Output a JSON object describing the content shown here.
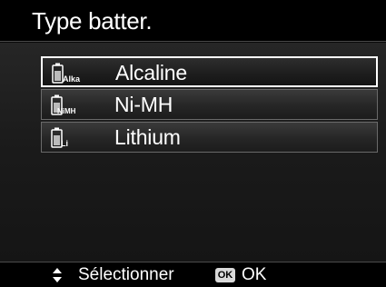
{
  "header": {
    "title": "Type batter."
  },
  "menu": {
    "items": [
      {
        "label": "Alcaline",
        "icon": "battery-alkaline-icon",
        "icon_text": "Alka",
        "selected": true
      },
      {
        "label": "Ni-MH",
        "icon": "battery-nimh-icon",
        "icon_text": "NiMH",
        "selected": false
      },
      {
        "label": "Lithium",
        "icon": "battery-lithium-icon",
        "icon_text": "Li",
        "selected": false
      }
    ]
  },
  "footer": {
    "navigate_icon": "up-down-arrows-icon",
    "select_label": "Sélectionner",
    "ok_badge": "OK",
    "ok_label": "OK"
  },
  "colors": {
    "selection_border": "#ffffff",
    "background": "#0a0a0a"
  }
}
